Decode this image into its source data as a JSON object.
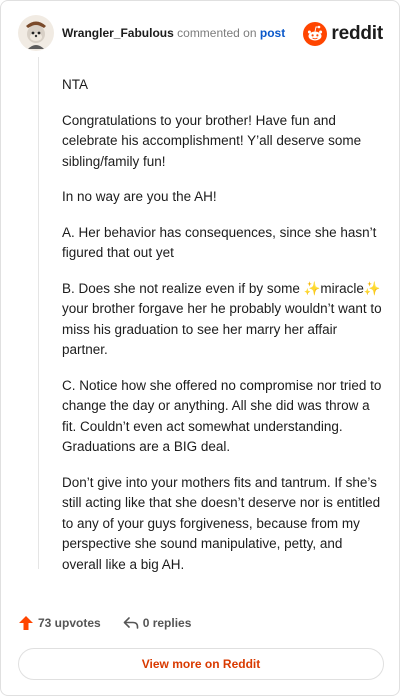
{
  "comment": {
    "username": "Wrangler_Fabulous",
    "action_text": "commented on",
    "post_link": "post",
    "brand": "reddit",
    "paragraphs": [
      "NTA",
      "Congratulations to your brother! Have fun and celebrate his accomplishment! Y’all deserve some sibling/family fun!",
      "In no way are you the AH!",
      "A. Her behavior has consequences, since she hasn’t figured that out yet",
      "B. Does she not realize even if by some ✨miracle✨ your brother forgave her he probably wouldn’t want to miss his graduation to see her marry her affair partner.",
      "C. Notice how she offered no compromise nor tried to change the day or anything. All she did was throw a fit. Couldn’t even act somewhat understanding. Graduations are a BIG deal.",
      "Don’t give into your mothers fits and tantrum. If she’s still acting like that she doesn’t deserve nor is entitled to any of your guys forgiveness, because from my perspective she sound manipulative, petty, and overall like a big AH."
    ]
  },
  "footer": {
    "upvotes": "73 upvotes",
    "replies": "0 replies",
    "view_more": "View more on Reddit"
  },
  "colors": {
    "accent": "#ff4500",
    "link": "#0a58ca",
    "view_more": "#d93a00"
  },
  "icons": {
    "avatar": "user-avatar",
    "brand": "reddit-snoo-icon",
    "upvote": "upvote-arrow-icon",
    "reply": "reply-arrow-icon"
  }
}
